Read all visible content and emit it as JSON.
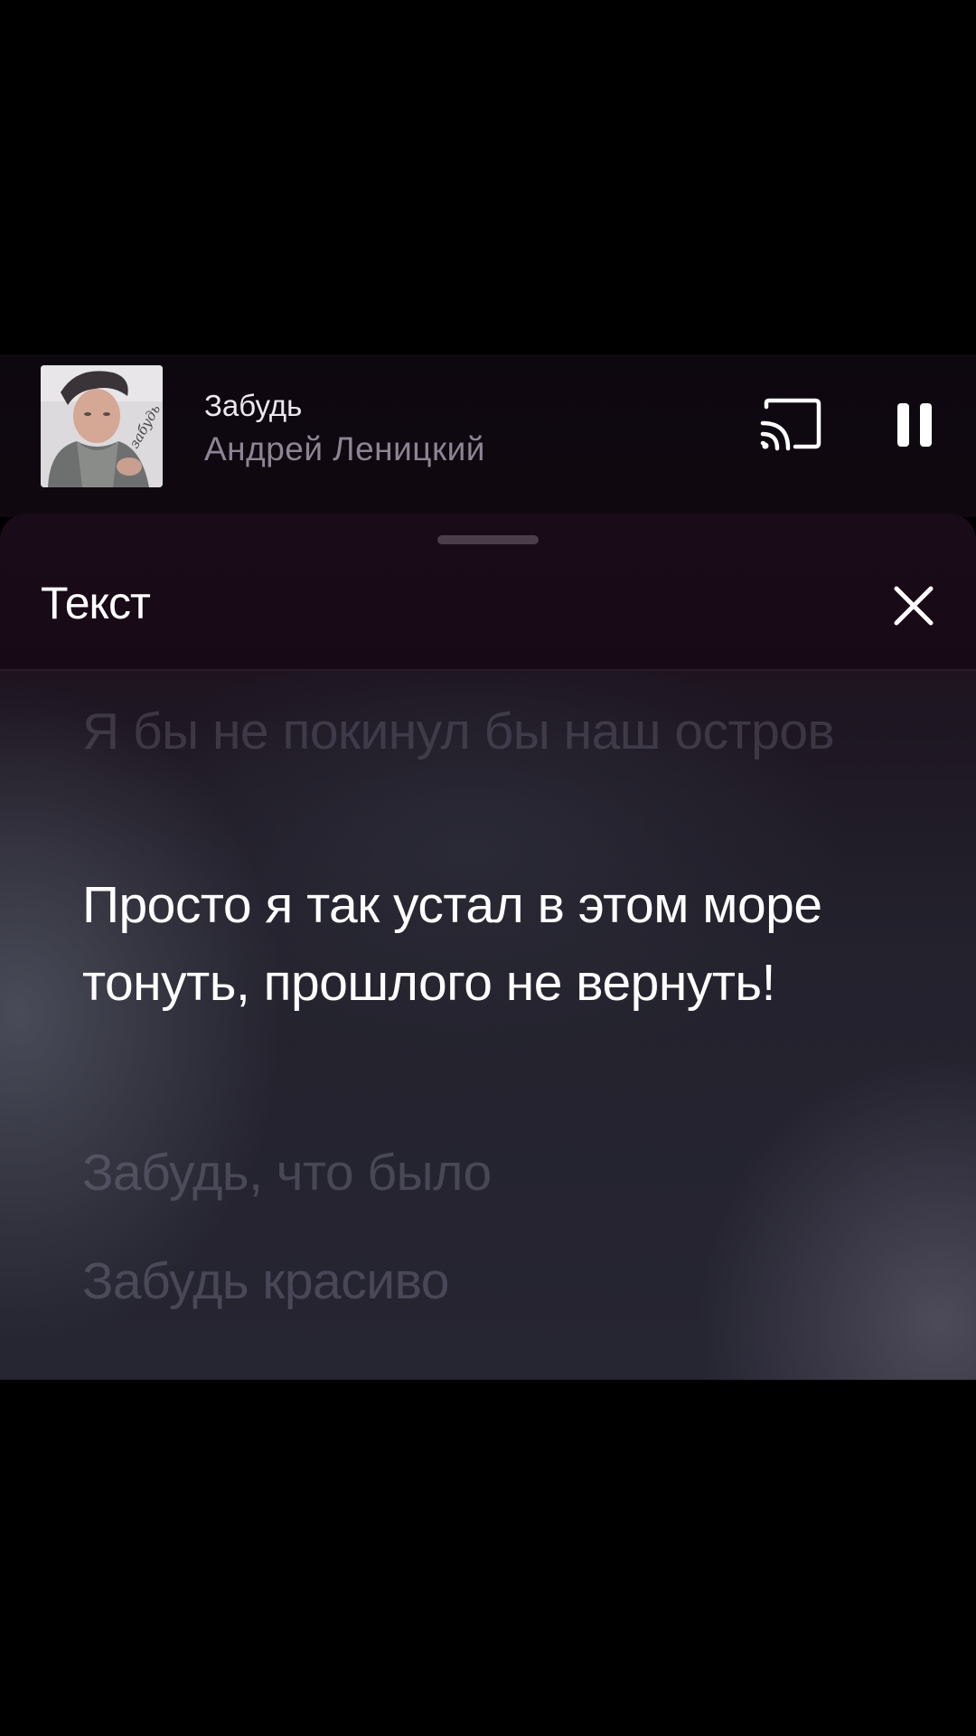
{
  "mini_player": {
    "title": "Забудь",
    "artist": "Андрей Леницкий",
    "album_art_icon": "album-cover",
    "cast_icon": "cast-icon",
    "pause_icon": "pause-icon",
    "album_art_text": "забудь"
  },
  "lyrics_sheet": {
    "title": "Текст",
    "close_icon": "close-icon",
    "lines": {
      "previous": "Я бы не покинул бы наш остров",
      "current": "Просто я так устал в этом море тонуть, прошлого не вернуть!",
      "next_1": "Забудь, что было",
      "next_2": "Забудь красиво"
    }
  },
  "colors": {
    "background": "#000000",
    "active_lyric": "#ffffff",
    "dim_lyric": "#7d7a8c",
    "artist_text": "#8d8494"
  }
}
